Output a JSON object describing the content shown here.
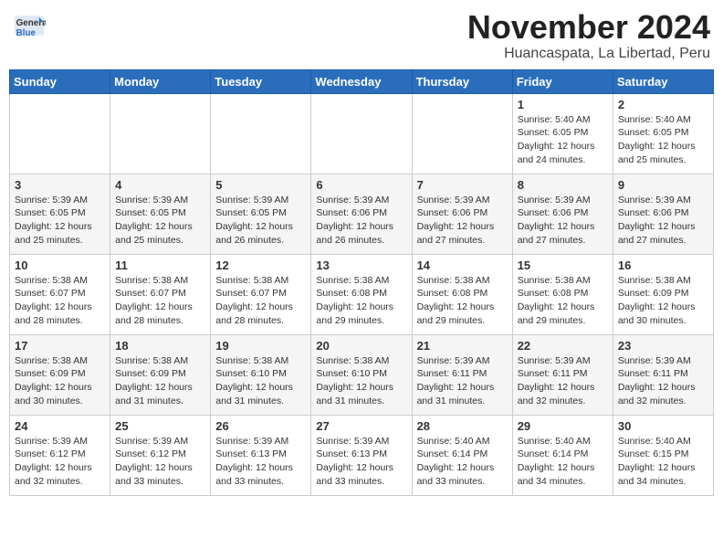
{
  "header": {
    "logo_general": "General",
    "logo_blue": "Blue",
    "month_title": "November 2024",
    "location": "Huancaspata, La Libertad, Peru"
  },
  "days_of_week": [
    "Sunday",
    "Monday",
    "Tuesday",
    "Wednesday",
    "Thursday",
    "Friday",
    "Saturday"
  ],
  "weeks": [
    [
      {
        "day": "",
        "info": ""
      },
      {
        "day": "",
        "info": ""
      },
      {
        "day": "",
        "info": ""
      },
      {
        "day": "",
        "info": ""
      },
      {
        "day": "",
        "info": ""
      },
      {
        "day": "1",
        "info": "Sunrise: 5:40 AM\nSunset: 6:05 PM\nDaylight: 12 hours and 24 minutes."
      },
      {
        "day": "2",
        "info": "Sunrise: 5:40 AM\nSunset: 6:05 PM\nDaylight: 12 hours and 25 minutes."
      }
    ],
    [
      {
        "day": "3",
        "info": "Sunrise: 5:39 AM\nSunset: 6:05 PM\nDaylight: 12 hours and 25 minutes."
      },
      {
        "day": "4",
        "info": "Sunrise: 5:39 AM\nSunset: 6:05 PM\nDaylight: 12 hours and 25 minutes."
      },
      {
        "day": "5",
        "info": "Sunrise: 5:39 AM\nSunset: 6:05 PM\nDaylight: 12 hours and 26 minutes."
      },
      {
        "day": "6",
        "info": "Sunrise: 5:39 AM\nSunset: 6:06 PM\nDaylight: 12 hours and 26 minutes."
      },
      {
        "day": "7",
        "info": "Sunrise: 5:39 AM\nSunset: 6:06 PM\nDaylight: 12 hours and 27 minutes."
      },
      {
        "day": "8",
        "info": "Sunrise: 5:39 AM\nSunset: 6:06 PM\nDaylight: 12 hours and 27 minutes."
      },
      {
        "day": "9",
        "info": "Sunrise: 5:39 AM\nSunset: 6:06 PM\nDaylight: 12 hours and 27 minutes."
      }
    ],
    [
      {
        "day": "10",
        "info": "Sunrise: 5:38 AM\nSunset: 6:07 PM\nDaylight: 12 hours and 28 minutes."
      },
      {
        "day": "11",
        "info": "Sunrise: 5:38 AM\nSunset: 6:07 PM\nDaylight: 12 hours and 28 minutes."
      },
      {
        "day": "12",
        "info": "Sunrise: 5:38 AM\nSunset: 6:07 PM\nDaylight: 12 hours and 28 minutes."
      },
      {
        "day": "13",
        "info": "Sunrise: 5:38 AM\nSunset: 6:08 PM\nDaylight: 12 hours and 29 minutes."
      },
      {
        "day": "14",
        "info": "Sunrise: 5:38 AM\nSunset: 6:08 PM\nDaylight: 12 hours and 29 minutes."
      },
      {
        "day": "15",
        "info": "Sunrise: 5:38 AM\nSunset: 6:08 PM\nDaylight: 12 hours and 29 minutes."
      },
      {
        "day": "16",
        "info": "Sunrise: 5:38 AM\nSunset: 6:09 PM\nDaylight: 12 hours and 30 minutes."
      }
    ],
    [
      {
        "day": "17",
        "info": "Sunrise: 5:38 AM\nSunset: 6:09 PM\nDaylight: 12 hours and 30 minutes."
      },
      {
        "day": "18",
        "info": "Sunrise: 5:38 AM\nSunset: 6:09 PM\nDaylight: 12 hours and 31 minutes."
      },
      {
        "day": "19",
        "info": "Sunrise: 5:38 AM\nSunset: 6:10 PM\nDaylight: 12 hours and 31 minutes."
      },
      {
        "day": "20",
        "info": "Sunrise: 5:38 AM\nSunset: 6:10 PM\nDaylight: 12 hours and 31 minutes."
      },
      {
        "day": "21",
        "info": "Sunrise: 5:39 AM\nSunset: 6:11 PM\nDaylight: 12 hours and 31 minutes."
      },
      {
        "day": "22",
        "info": "Sunrise: 5:39 AM\nSunset: 6:11 PM\nDaylight: 12 hours and 32 minutes."
      },
      {
        "day": "23",
        "info": "Sunrise: 5:39 AM\nSunset: 6:11 PM\nDaylight: 12 hours and 32 minutes."
      }
    ],
    [
      {
        "day": "24",
        "info": "Sunrise: 5:39 AM\nSunset: 6:12 PM\nDaylight: 12 hours and 32 minutes."
      },
      {
        "day": "25",
        "info": "Sunrise: 5:39 AM\nSunset: 6:12 PM\nDaylight: 12 hours and 33 minutes."
      },
      {
        "day": "26",
        "info": "Sunrise: 5:39 AM\nSunset: 6:13 PM\nDaylight: 12 hours and 33 minutes."
      },
      {
        "day": "27",
        "info": "Sunrise: 5:39 AM\nSunset: 6:13 PM\nDaylight: 12 hours and 33 minutes."
      },
      {
        "day": "28",
        "info": "Sunrise: 5:40 AM\nSunset: 6:14 PM\nDaylight: 12 hours and 33 minutes."
      },
      {
        "day": "29",
        "info": "Sunrise: 5:40 AM\nSunset: 6:14 PM\nDaylight: 12 hours and 34 minutes."
      },
      {
        "day": "30",
        "info": "Sunrise: 5:40 AM\nSunset: 6:15 PM\nDaylight: 12 hours and 34 minutes."
      }
    ]
  ]
}
